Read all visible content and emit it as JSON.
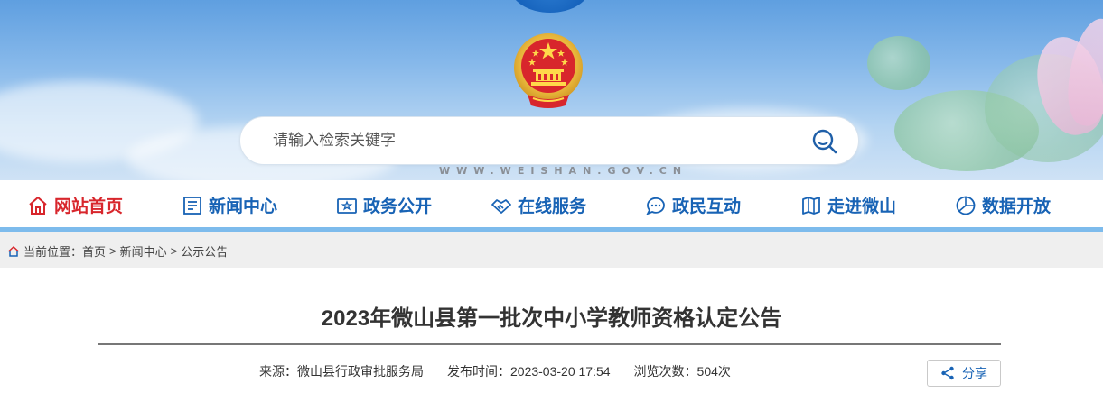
{
  "header": {
    "search_placeholder": "请输入检索关键字",
    "domain": "WWW.WEISHAN.GOV.CN"
  },
  "nav": {
    "items": [
      {
        "label": "网站首页",
        "icon": "home-icon",
        "active": true
      },
      {
        "label": "新闻中心",
        "icon": "news-icon",
        "active": false
      },
      {
        "label": "政务公开",
        "icon": "gov-affairs-icon",
        "active": false
      },
      {
        "label": "在线服务",
        "icon": "handshake-icon",
        "active": false
      },
      {
        "label": "政民互动",
        "icon": "chat-icon",
        "active": false
      },
      {
        "label": "走进微山",
        "icon": "map-icon",
        "active": false
      },
      {
        "label": "数据开放",
        "icon": "data-icon",
        "active": false
      }
    ]
  },
  "breadcrumb": {
    "prefix": "当前位置：",
    "items": [
      "首页",
      "新闻中心",
      "公示公告"
    ],
    "separator": ">"
  },
  "article": {
    "title": "2023年微山县第一批次中小学教师资格认定公告",
    "source": "来源：微山县行政审批服务局",
    "published": "发布时间：2023-03-20 17:54",
    "views": "浏览次数：504次",
    "share_label": "分享"
  },
  "colors": {
    "nav_text": "#1863b5",
    "nav_active": "#d8262c",
    "nav_underline": "#7dbbec",
    "breadcrumb_bg": "#efefef"
  }
}
